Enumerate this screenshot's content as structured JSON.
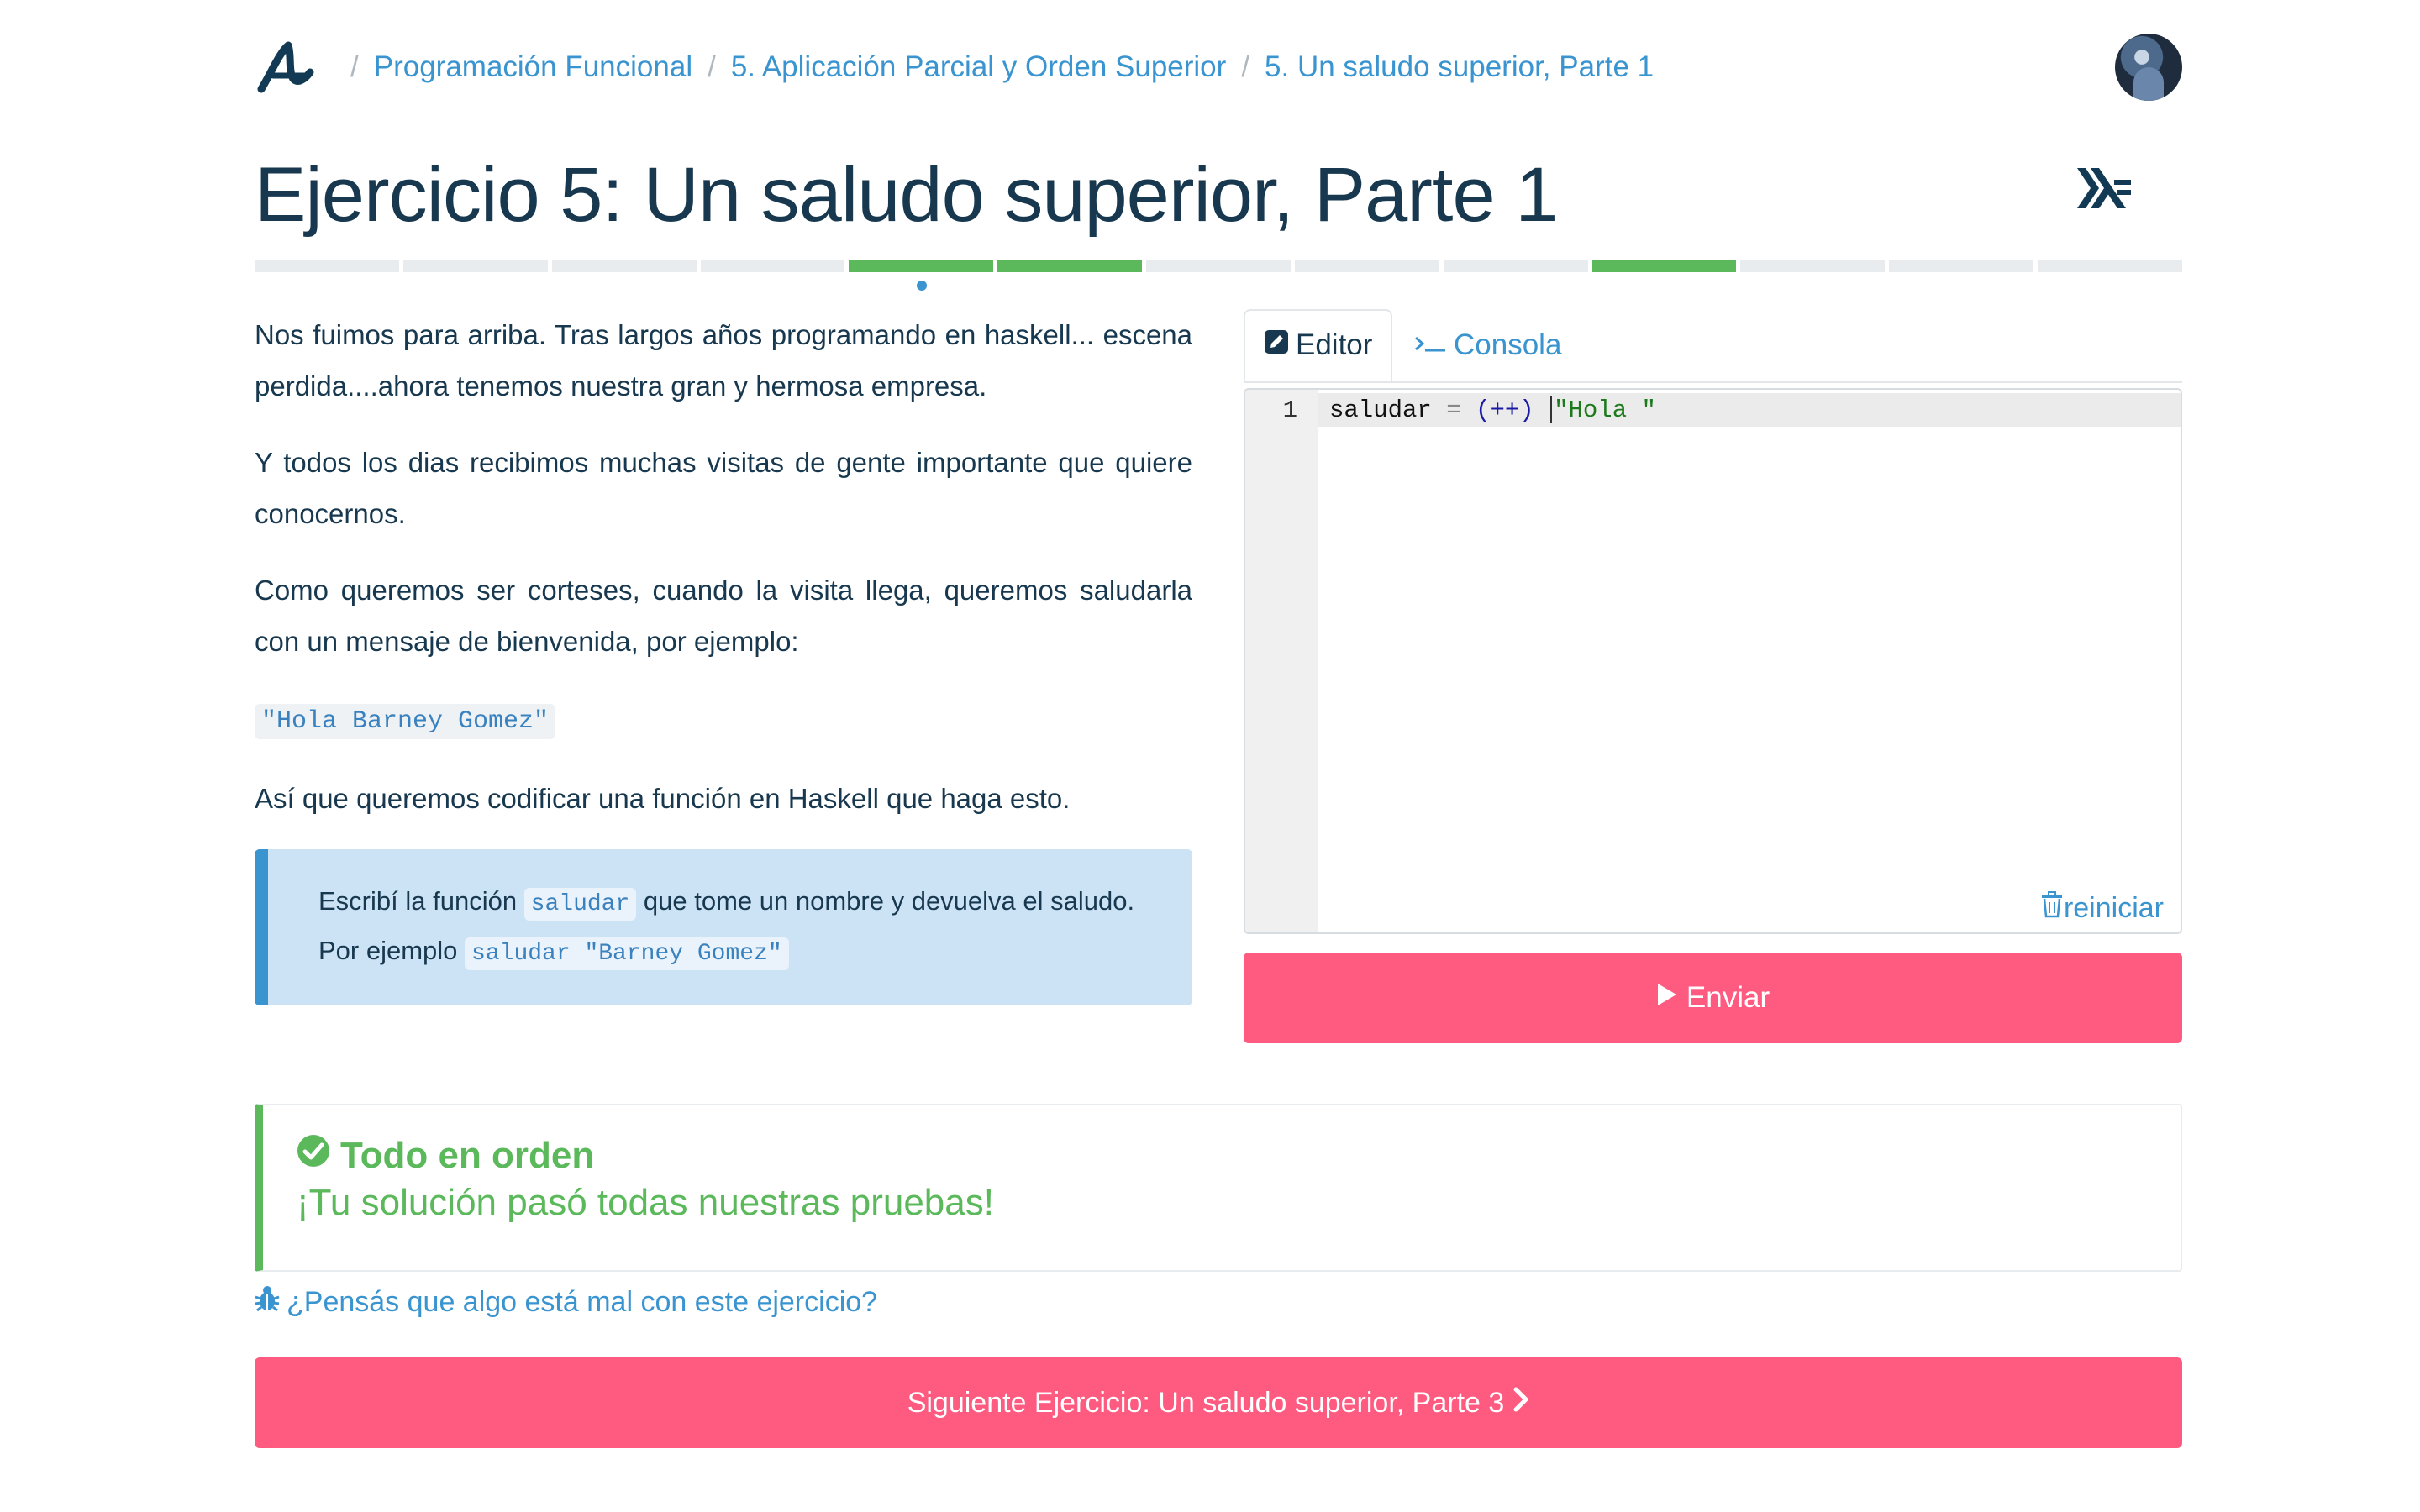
{
  "colors": {
    "brand_blue": "#3a94d0",
    "title_dark": "#17384f",
    "success_green": "#5bb85b",
    "primary_button": "#ff5b81",
    "progress_empty": "#e8ecef"
  },
  "header": {
    "logo_icon": "mumuki-logo-icon",
    "breadcrumbs": [
      "Programación Funcional",
      "5. Aplicación Parcial y Orden Superior",
      "5. Un saludo superior, Parte 1"
    ],
    "separator": "/",
    "avatar_icon": "user-avatar"
  },
  "exercise": {
    "title": "Ejercicio 5: Un saludo superior, Parte 1",
    "language_icon": "haskell-icon"
  },
  "progress": {
    "segments": [
      "pending",
      "pending",
      "pending",
      "pending",
      "passed",
      "passed",
      "pending",
      "pending",
      "pending",
      "passed",
      "pending",
      "pending",
      "pending"
    ],
    "current_index": 4
  },
  "description": {
    "p1": "Nos fuimos para arriba. Tras largos años programando en haskell... escena perdida....ahora tenemos nuestra gran y hermosa empresa.",
    "p2": "Y todos los dias recibimos muchas visitas de gente importante que quiere conocernos.",
    "p3": "Como queremos ser corteses, cuando la visita llega, queremos saludarla con un mensaje de bienvenida, por ejemplo:",
    "example_code": "\"Hola Barney Gomez\"",
    "p4": "Así que queremos codificar una función en Haskell que haga esto.",
    "task": {
      "text_before": "Escribí la función ",
      "code1": "saludar",
      "text_middle": " que tome un nombre y devuelva el saludo. Por ejemplo ",
      "code2": "saludar \"Barney Gomez\""
    }
  },
  "editor": {
    "tab_editor": "Editor",
    "tab_console": "Consola",
    "tab_editor_icon": "pencil-square-icon",
    "tab_console_icon": "terminal-icon",
    "line_number": "1",
    "code": {
      "name": "saludar",
      "eq": "=",
      "op": "(++)",
      "str": "\"Hola \""
    },
    "reset_label": "reiniciar",
    "reset_icon": "trash-icon"
  },
  "submit": {
    "label": "Enviar",
    "icon": "play-icon"
  },
  "result": {
    "title": "Todo en orden",
    "message": "¡Tu solución pasó todas nuestras pruebas!",
    "icon": "check-circle-icon"
  },
  "report": {
    "label": "¿Pensás que algo está mal con este ejercicio?",
    "icon": "bug-icon"
  },
  "next": {
    "label": "Siguiente Ejercicio: Un saludo superior, Parte 3",
    "icon": "chevron-right-icon"
  }
}
